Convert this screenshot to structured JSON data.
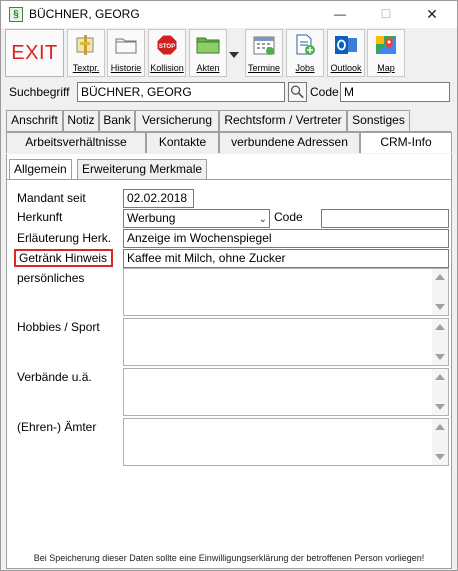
{
  "window": {
    "title": "BÜCHNER, GEORG",
    "app_icon_glyph": "§"
  },
  "toolbar": {
    "exit_label": "EXIT",
    "buttons": [
      {
        "label": "Textpr.",
        "icon": "text-processor-icon"
      },
      {
        "label": "Historie",
        "icon": "folder-icon"
      },
      {
        "label": "Kollision",
        "icon": "stop-sign-icon"
      },
      {
        "label": "Akten",
        "icon": "green-folder-icon"
      },
      {
        "label": "Termine",
        "icon": "calendar-icon"
      },
      {
        "label": "Jobs",
        "icon": "document-add-icon"
      },
      {
        "label": "Outlook",
        "icon": "outlook-icon"
      },
      {
        "label": "Map",
        "icon": "map-icon"
      }
    ]
  },
  "search": {
    "label": "Suchbegriff",
    "value": "BÜCHNER, GEORG",
    "code_label": "Code",
    "code_value": "M"
  },
  "tabs_row1": [
    "Anschrift",
    "Notiz",
    "Bank",
    "Versicherung",
    "Rechtsform / Vertreter",
    "Sonstiges"
  ],
  "tabs_row2": [
    "Arbeitsverhältnisse",
    "Kontakte",
    "verbundene Adressen",
    "CRM-Info"
  ],
  "subtabs": [
    "Allgemein",
    "Erweiterung Merkmale"
  ],
  "form": {
    "mandant_seit_label": "Mandant seit",
    "mandant_seit_value": "02.02.2018",
    "herkunft_label": "Herkunft",
    "herkunft_value": "Werbung",
    "code_label": "Code",
    "code_value": "",
    "erlaeuterung_label": "Erläuterung Herk.",
    "erlaeuterung_value": "Anzeige im Wochenspiegel",
    "getraenk_label": "Getränk Hinweis",
    "getraenk_value": "Kaffee mit Milch, ohne Zucker",
    "persoenliches_label": "persönliches",
    "hobbies_label": "Hobbies / Sport",
    "verbaende_label": "Verbände u.ä.",
    "aemter_label": "(Ehren-) Ämter"
  },
  "footer_note": "Bei Speicherung dieser Daten sollte eine Einwilligungserklärung der betroffenen Person vorliegen!"
}
